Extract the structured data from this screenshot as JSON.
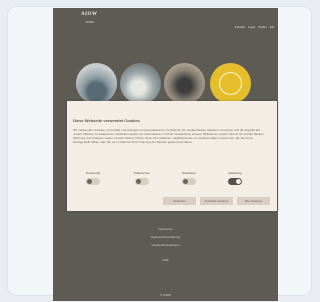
{
  "site": {
    "logo": "AIOW",
    "logo_sub": "LIMBO",
    "nav": [
      "Kontakt",
      "Login",
      "Suche",
      "EN"
    ]
  },
  "categories": [
    "",
    "",
    "",
    ""
  ],
  "cookie_banner": {
    "title": "Diese Webseite verwendet Cookies",
    "text": "Wir verwenden Cookies, um Inhalte und Anzeigen zu personalisieren, Funktionen für soziale Medien anbieten zu können und die Zugriffe auf unsere Website zu analysieren. Außerdem geben wir Informationen zu Ihrer Verwendung unserer Website an unsere Partner für soziale Medien, Werbung und Analysen weiter. Unsere Partner führen diese Informationen möglicherweise mit weiteren Daten zusammen, die Sie ihnen bereitgestellt haben oder die sie im Rahmen Ihrer Nutzung der Dienste gesammelt haben.",
    "toggles": [
      {
        "label": "Notwendig",
        "on": false
      },
      {
        "label": "Präferenzen",
        "on": false
      },
      {
        "label": "Statistiken",
        "on": false
      },
      {
        "label": "Marketing",
        "on": true
      }
    ],
    "buttons": {
      "decline": "Ablehnen",
      "allow_selection": "Auswahl erlauben",
      "allow_all": "Alle zulassen"
    }
  },
  "footer": {
    "lines": [
      "Impressum",
      "Datenschutzerklärung",
      "Cookie-Einstellungen",
      "AGB",
      "© AIOW"
    ]
  }
}
